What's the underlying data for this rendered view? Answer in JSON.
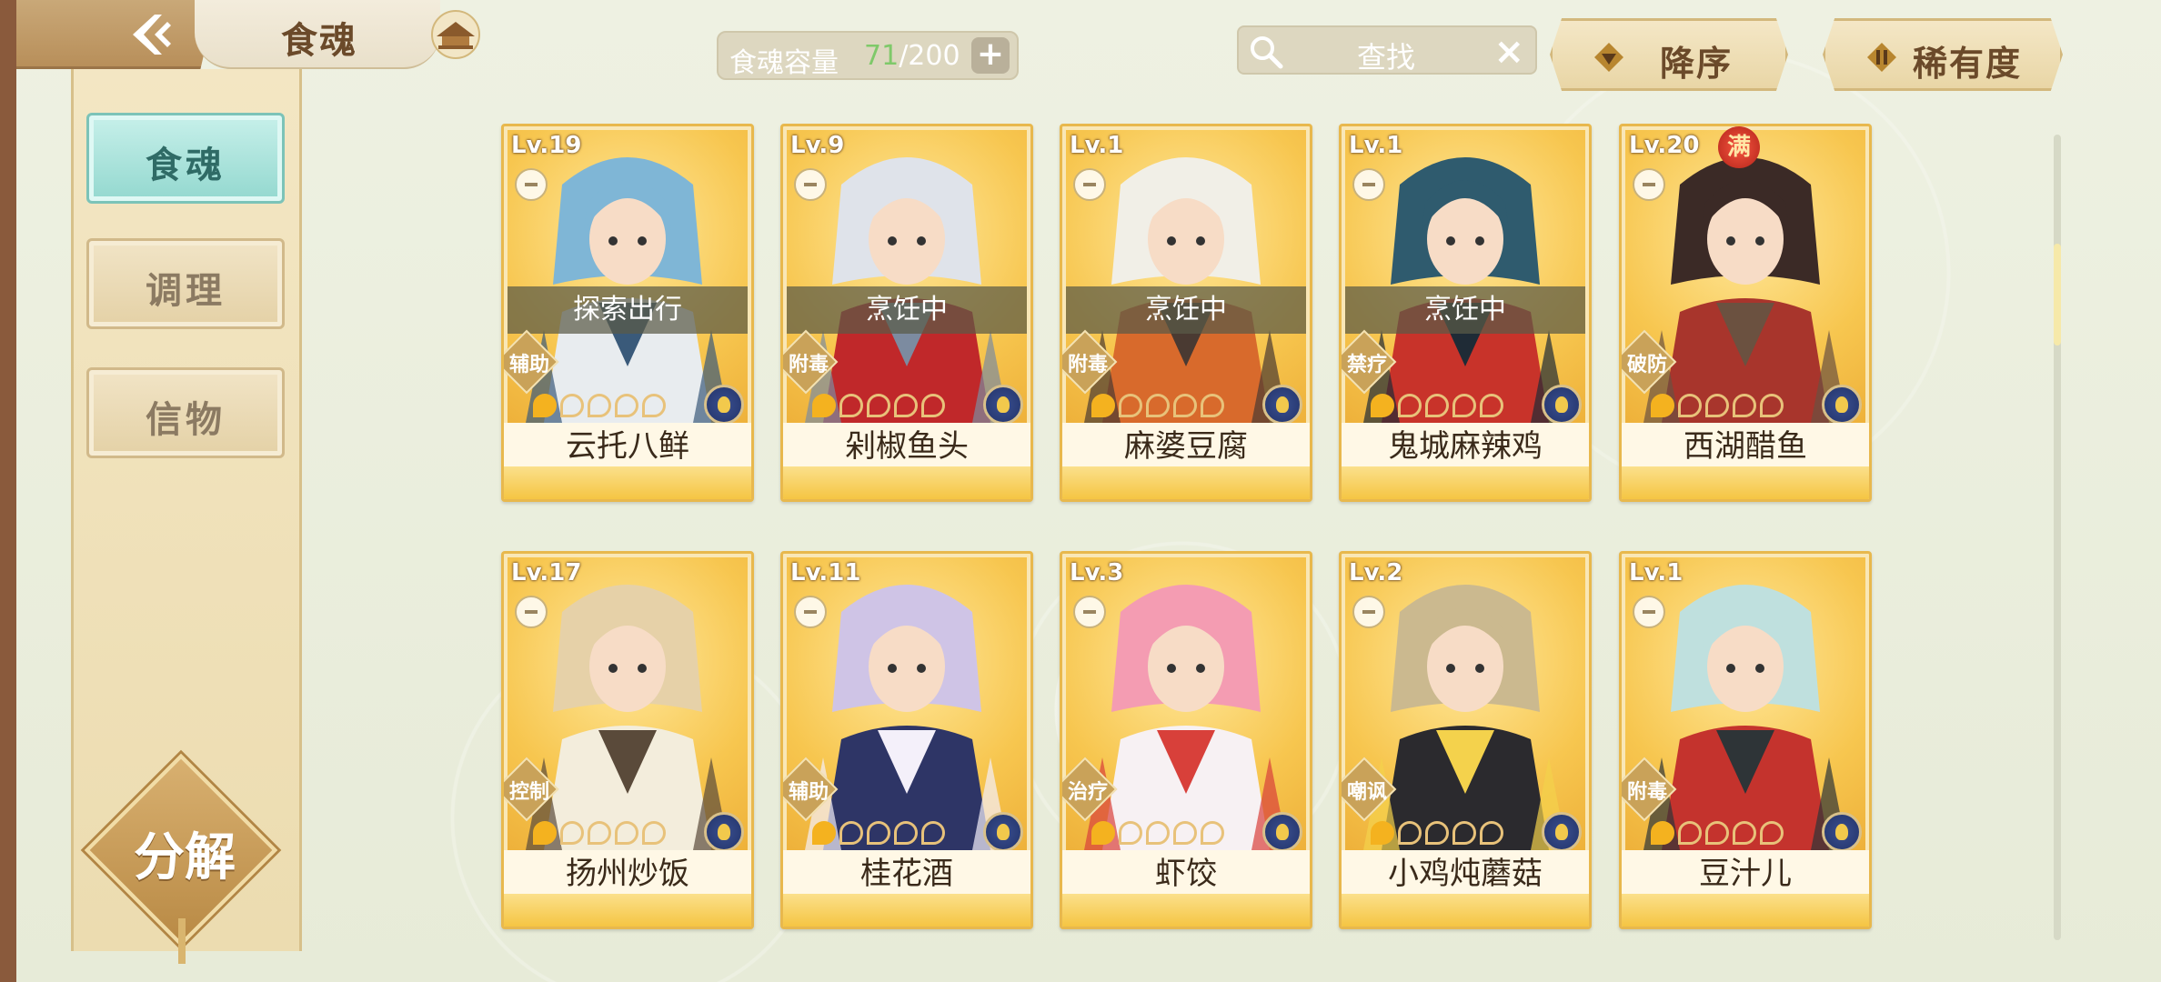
{
  "header": {
    "title": "食魂",
    "back_icon": "back-chevron-icon",
    "archive_icon": "pavilion-icon"
  },
  "capacity": {
    "label": "食魂容量",
    "current": "71",
    "max": "/200",
    "plus": "+"
  },
  "search": {
    "label": "查找",
    "close": "×"
  },
  "sort": {
    "order_label": "降序",
    "rarity_label": "稀有度"
  },
  "sidebar": {
    "items": [
      {
        "label": "食魂",
        "active": true
      },
      {
        "label": "调理",
        "active": false
      },
      {
        "label": "信物",
        "active": false
      }
    ],
    "decompose_label": "分解"
  },
  "cards": [
    {
      "level": "Lv.19",
      "name": "云托八鲜",
      "status": "探索出行",
      "role": "辅助",
      "stars": 1,
      "max": "",
      "palette": [
        "#7fb6d6",
        "#e8ecef",
        "#3a5a7a"
      ]
    },
    {
      "level": "Lv.9",
      "name": "剁椒鱼头",
      "status": "烹饪中",
      "role": "附毒",
      "stars": 1,
      "max": "",
      "palette": [
        "#dfe3ea",
        "#c0282a",
        "#7c8ba0"
      ]
    },
    {
      "level": "Lv.1",
      "name": "麻婆豆腐",
      "status": "烹饪中",
      "role": "附毒",
      "stars": 1,
      "max": "",
      "palette": [
        "#f1efe7",
        "#d86a2c",
        "#4a3a32"
      ]
    },
    {
      "level": "Lv.1",
      "name": "鬼城麻辣鸡",
      "status": "烹饪中",
      "role": "禁疗",
      "stars": 1,
      "max": "",
      "palette": [
        "#2f5b6e",
        "#c8332a",
        "#1f2b36"
      ]
    },
    {
      "level": "Lv.20",
      "name": "西湖醋鱼",
      "status": "",
      "role": "破防",
      "stars": 1,
      "max": "满",
      "palette": [
        "#3b2a26",
        "#a8352c",
        "#6b5140"
      ]
    },
    {
      "level": "Lv.17",
      "name": "扬州炒饭",
      "status": "",
      "role": "控制",
      "stars": 1,
      "max": "",
      "palette": [
        "#e6d1a8",
        "#f3eddc",
        "#5a4a3a"
      ]
    },
    {
      "level": "Lv.11",
      "name": "桂花酒",
      "status": "",
      "role": "辅助",
      "stars": 1,
      "max": "",
      "palette": [
        "#cfc4e6",
        "#2e3566",
        "#f4f0fa"
      ]
    },
    {
      "level": "Lv.3",
      "name": "虾饺",
      "status": "",
      "role": "治疗",
      "stars": 1,
      "max": "",
      "palette": [
        "#f49cb2",
        "#f7f1f3",
        "#d8403a"
      ]
    },
    {
      "level": "Lv.2",
      "name": "小鸡炖蘑菇",
      "status": "",
      "role": "嘲讽",
      "stars": 1,
      "max": "",
      "palette": [
        "#cbb98f",
        "#2b2a2e",
        "#f4d24c"
      ]
    },
    {
      "level": "Lv.1",
      "name": "豆汁儿",
      "status": "",
      "role": "附毒",
      "stars": 1,
      "max": "",
      "palette": [
        "#bfe0de",
        "#c4332d",
        "#2e3437"
      ]
    }
  ],
  "colors": {
    "card_border": "#e8b84d",
    "active_tab": "#93d8cf",
    "capacity_current": "#7fc96a"
  }
}
